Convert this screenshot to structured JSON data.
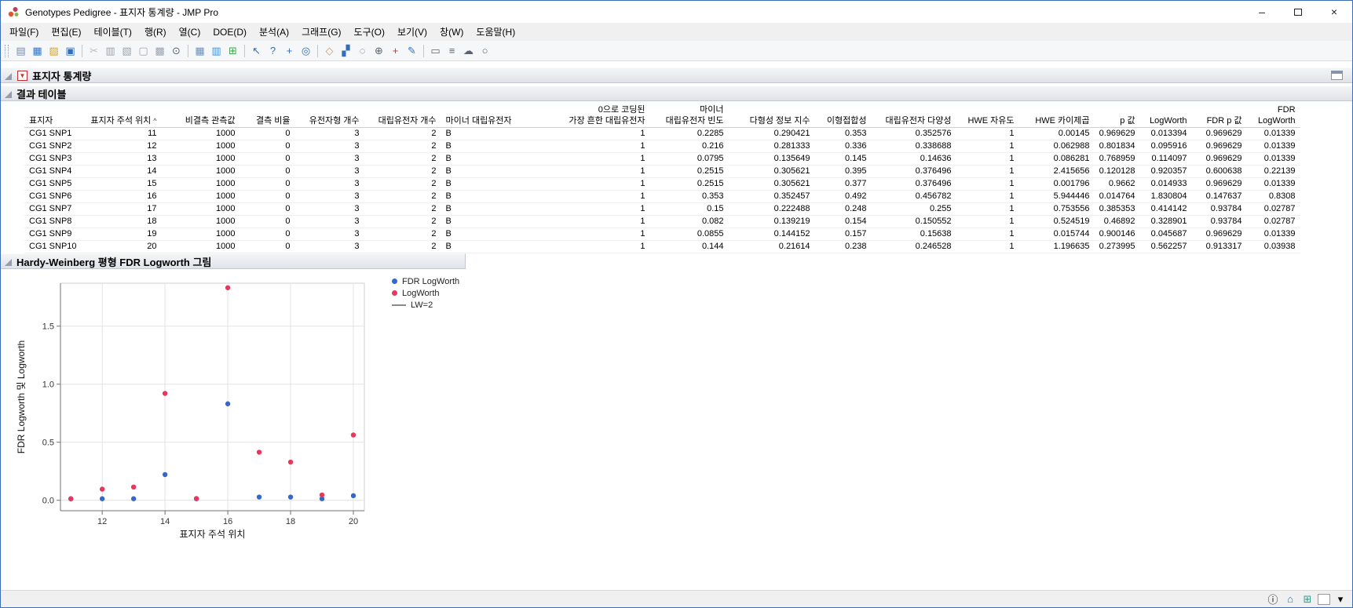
{
  "window": {
    "title": "Genotypes Pedigree - 표지자 통계량 - JMP Pro",
    "controls": {
      "minimize": "–",
      "close": "×"
    }
  },
  "menubar": {
    "items": [
      {
        "name": "file",
        "label": "파일(F)"
      },
      {
        "name": "edit",
        "label": "편집(E)"
      },
      {
        "name": "tables",
        "label": "테이블(T)"
      },
      {
        "name": "rows",
        "label": "행(R)"
      },
      {
        "name": "cols",
        "label": "열(C)"
      },
      {
        "name": "doe",
        "label": "DOE(D)"
      },
      {
        "name": "analyze",
        "label": "분석(A)"
      },
      {
        "name": "graph",
        "label": "그래프(G)"
      },
      {
        "name": "tools",
        "label": "도구(O)"
      },
      {
        "name": "view",
        "label": "보기(V)"
      },
      {
        "name": "window",
        "label": "창(W)"
      },
      {
        "name": "help",
        "label": "도움말(H)"
      }
    ]
  },
  "toolbar": {
    "groups": [
      [
        {
          "name": "new-journal-icon",
          "glyph": "▤",
          "color": "#7a8aa8"
        },
        {
          "name": "new-data-table-icon",
          "glyph": "▦",
          "color": "#3a74c0"
        },
        {
          "name": "open-icon",
          "glyph": "▨",
          "color": "#d9a426"
        },
        {
          "name": "save-icon",
          "glyph": "▣",
          "color": "#2f6fbe"
        }
      ],
      [
        {
          "name": "cut-icon",
          "glyph": "✂",
          "color": "#bcbcbc"
        },
        {
          "name": "copy-icon",
          "glyph": "▥",
          "color": "#9aa4b0"
        },
        {
          "name": "paste-icon",
          "glyph": "▧",
          "color": "#9aa4b0"
        },
        {
          "name": "journal-icon",
          "glyph": "▢",
          "color": "#9aa4b0"
        },
        {
          "name": "layout-icon",
          "glyph": "▩",
          "color": "#9aa4b0"
        },
        {
          "name": "search-icon",
          "glyph": "⊙",
          "color": "#5a6470"
        }
      ],
      [
        {
          "name": "data-table-icon",
          "glyph": "▦",
          "color": "#6b8fc2"
        },
        {
          "name": "chart-icon",
          "glyph": "▥",
          "color": "#4a90d9"
        },
        {
          "name": "graph-builder-icon",
          "glyph": "⊞",
          "color": "#3fa34d"
        }
      ],
      [
        {
          "name": "arrow-tool-icon",
          "glyph": "↖",
          "color": "#2f6fbe"
        },
        {
          "name": "help-tool-icon",
          "glyph": "?",
          "color": "#2f6fbe"
        },
        {
          "name": "crosshair-tool-icon",
          "glyph": "+",
          "color": "#2f6fbe"
        },
        {
          "name": "target-tool-icon",
          "glyph": "◎",
          "color": "#2f6fbe"
        }
      ],
      [
        {
          "name": "hand-tool-icon",
          "glyph": "◇",
          "color": "#c9996a"
        },
        {
          "name": "brush-tool-icon",
          "glyph": "▞",
          "color": "#2f6fbe"
        },
        {
          "name": "lasso-tool-icon",
          "glyph": "◌",
          "color": "#5a6470"
        },
        {
          "name": "magnifier-tool-icon",
          "glyph": "⊕",
          "color": "#5a6470"
        },
        {
          "name": "plus-tool-icon",
          "glyph": "+",
          "color": "#c03a3a"
        },
        {
          "name": "pencil-tool-icon",
          "glyph": "✎",
          "color": "#2f6fbe"
        }
      ],
      [
        {
          "name": "annotate-rect-icon",
          "glyph": "▭",
          "color": "#5a6470"
        },
        {
          "name": "line-annotation-icon",
          "glyph": "≡",
          "color": "#5a6470"
        },
        {
          "name": "cloud-annotation-icon",
          "glyph": "☁",
          "color": "#5a6470"
        },
        {
          "name": "oval-annotation-icon",
          "glyph": "○",
          "color": "#5a6470"
        }
      ]
    ]
  },
  "report": {
    "title": "표지자 통계량",
    "sections": {
      "table": "결과 테이블",
      "chart": "Hardy-Weinberg 평형 FDR Logworth 그림"
    }
  },
  "table": {
    "columns": [
      {
        "label": "표지자"
      },
      {
        "label": "표지자 주석 위치",
        "sort": "^"
      },
      {
        "label": "비결측 관측값"
      },
      {
        "label": "결측 비율"
      },
      {
        "label": "유전자형 개수"
      },
      {
        "label": "대립유전자 개수"
      },
      {
        "label": "마이너 대립유전자"
      },
      {
        "label": "0으로 코딩된\n가장 흔한 대립유전자"
      },
      {
        "label": "마이너\n대립유전자 빈도"
      },
      {
        "label": "다형성 정보 지수"
      },
      {
        "label": "이형접합성"
      },
      {
        "label": "대립유전자 다양성"
      },
      {
        "label": "HWE 자유도"
      },
      {
        "label": "HWE 카이제곱"
      },
      {
        "label": "p 값"
      },
      {
        "label": "LogWorth"
      },
      {
        "label": "FDR p 값"
      },
      {
        "label": "FDR\nLogWorth"
      }
    ],
    "rows": [
      [
        "CG1 SNP1",
        "11",
        "1000",
        "0",
        "3",
        "2",
        "B",
        "1",
        "0.2285",
        "0.290421",
        "0.353",
        "0.352576",
        "1",
        "0.00145",
        "0.969629",
        "0.013394",
        "0.969629",
        "0.01339"
      ],
      [
        "CG1 SNP2",
        "12",
        "1000",
        "0",
        "3",
        "2",
        "B",
        "1",
        "0.216",
        "0.281333",
        "0.336",
        "0.338688",
        "1",
        "0.062988",
        "0.801834",
        "0.095916",
        "0.969629",
        "0.01339"
      ],
      [
        "CG1 SNP3",
        "13",
        "1000",
        "0",
        "3",
        "2",
        "B",
        "1",
        "0.0795",
        "0.135649",
        "0.145",
        "0.14636",
        "1",
        "0.086281",
        "0.768959",
        "0.114097",
        "0.969629",
        "0.01339"
      ],
      [
        "CG1 SNP4",
        "14",
        "1000",
        "0",
        "3",
        "2",
        "B",
        "1",
        "0.2515",
        "0.305621",
        "0.395",
        "0.376496",
        "1",
        "2.415656",
        "0.120128",
        "0.920357",
        "0.600638",
        "0.22139"
      ],
      [
        "CG1 SNP5",
        "15",
        "1000",
        "0",
        "3",
        "2",
        "B",
        "1",
        "0.2515",
        "0.305621",
        "0.377",
        "0.376496",
        "1",
        "0.001796",
        "0.9662",
        "0.014933",
        "0.969629",
        "0.01339"
      ],
      [
        "CG1 SNP6",
        "16",
        "1000",
        "0",
        "3",
        "2",
        "B",
        "1",
        "0.353",
        "0.352457",
        "0.492",
        "0.456782",
        "1",
        "5.944446",
        "0.014764",
        "1.830804",
        "0.147637",
        "0.8308"
      ],
      [
        "CG1 SNP7",
        "17",
        "1000",
        "0",
        "3",
        "2",
        "B",
        "1",
        "0.15",
        "0.222488",
        "0.248",
        "0.255",
        "1",
        "0.753556",
        "0.385353",
        "0.414142",
        "0.93784",
        "0.02787"
      ],
      [
        "CG1 SNP8",
        "18",
        "1000",
        "0",
        "3",
        "2",
        "B",
        "1",
        "0.082",
        "0.139219",
        "0.154",
        "0.150552",
        "1",
        "0.524519",
        "0.46892",
        "0.328901",
        "0.93784",
        "0.02787"
      ],
      [
        "CG1 SNP9",
        "19",
        "1000",
        "0",
        "3",
        "2",
        "B",
        "1",
        "0.0855",
        "0.144152",
        "0.157",
        "0.15638",
        "1",
        "0.015744",
        "0.900146",
        "0.045687",
        "0.969629",
        "0.01339"
      ],
      [
        "CG1 SNP10",
        "20",
        "1000",
        "0",
        "3",
        "2",
        "B",
        "1",
        "0.144",
        "0.21614",
        "0.238",
        "0.246528",
        "1",
        "1.196635",
        "0.273995",
        "0.562257",
        "0.913317",
        "0.03938"
      ]
    ]
  },
  "chart_data": {
    "type": "scatter",
    "title": "Hardy-Weinberg 평형 FDR Logworth 그림",
    "xlabel": "표지자 주석 위치",
    "ylabel": "FDR Logworth 및 Logworth",
    "xlim": [
      10.67,
      20.35
    ],
    "ylim": [
      -0.09,
      1.87
    ],
    "xticks": [
      12,
      14,
      16,
      18,
      20
    ],
    "yticks": [
      0,
      0.5,
      1,
      1.5
    ],
    "grid": true,
    "legend_position": "right-top",
    "series": [
      {
        "name": "FDR LogWorth",
        "color": "#3668c9",
        "marker": "circle",
        "x": [
          11,
          12,
          13,
          14,
          15,
          16,
          17,
          18,
          19,
          20
        ],
        "y": [
          0.01339,
          0.01339,
          0.01339,
          0.22139,
          0.01339,
          0.8308,
          0.02787,
          0.02787,
          0.01339,
          0.03938
        ]
      },
      {
        "name": "LogWorth",
        "color": "#e8365d",
        "marker": "circle",
        "x": [
          11,
          12,
          13,
          14,
          15,
          16,
          17,
          18,
          19,
          20
        ],
        "y": [
          0.013394,
          0.095916,
          0.114097,
          0.920357,
          0.014933,
          1.830804,
          0.414142,
          0.328901,
          0.045687,
          0.562257
        ]
      }
    ],
    "reference_line": {
      "label": "LW=2",
      "value": 2,
      "color": "#888888"
    }
  },
  "statusbar": {
    "icons": [
      {
        "name": "info-icon",
        "glyph": "ⓘ"
      },
      {
        "name": "home-window-icon",
        "glyph": "⌂"
      },
      {
        "name": "grid-view-icon",
        "glyph": "⊞"
      },
      {
        "name": "preview-box",
        "glyph": ""
      },
      {
        "name": "caret-down-icon",
        "glyph": "▾"
      }
    ]
  }
}
